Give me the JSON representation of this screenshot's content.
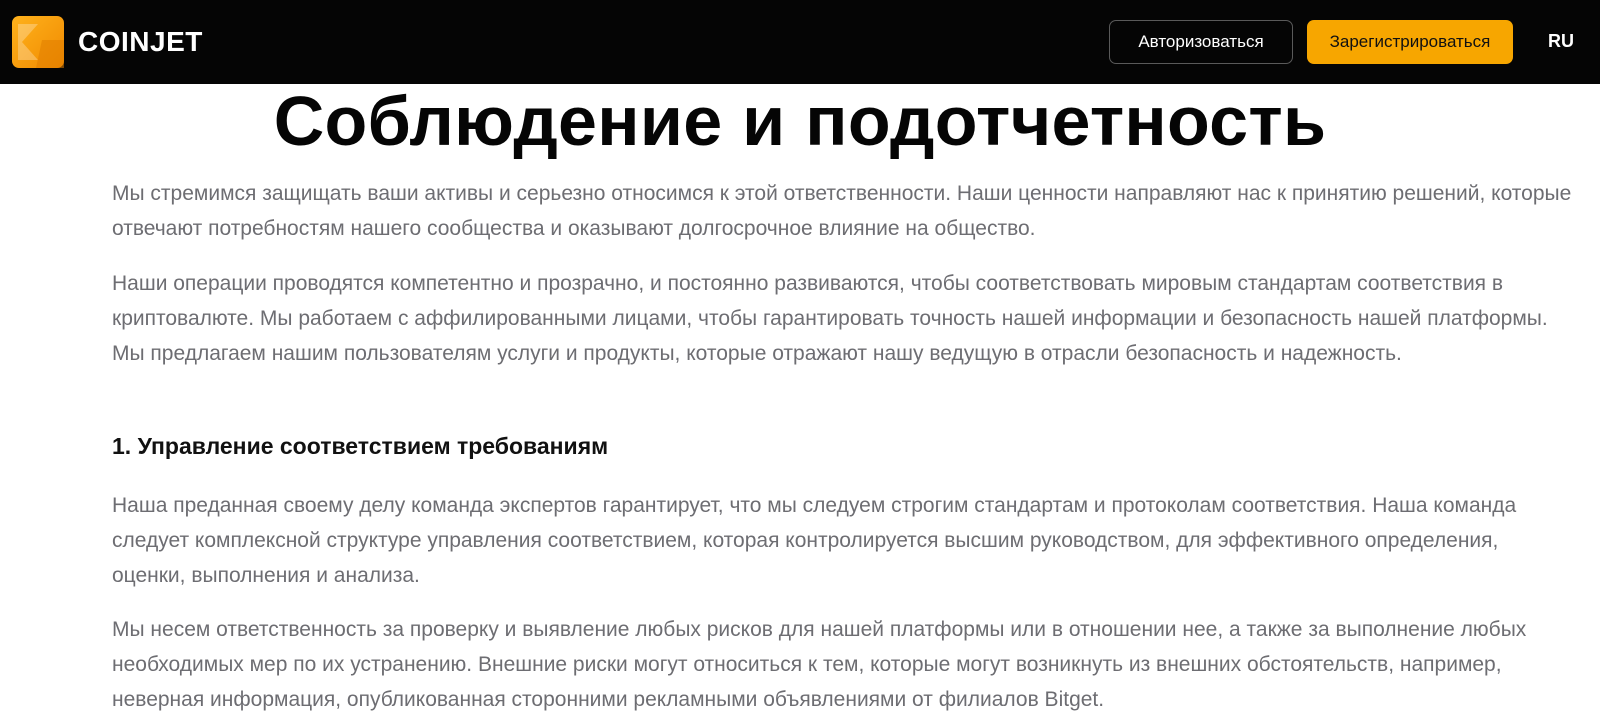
{
  "header": {
    "brand": "COINJET",
    "login_label": "Авторизоваться",
    "register_label": "Зарегистрироваться",
    "language": "RU",
    "accent_color": "#f7a600",
    "logo_icon": "coinjet-logo-icon"
  },
  "page": {
    "title": "Соблюдение и подотчетность",
    "intro_1": "Мы стремимся защищать ваши активы и серьезно относимся к этой ответственности. Наши ценности направляют нас к принятию решений, которые отвечают потребностям нашего сообщества и оказывают долгосрочное влияние на общество.",
    "intro_2": "Наши операции проводятся компетентно и прозрачно, и постоянно развиваются, чтобы соответствовать мировым стандартам соответствия в криптовалюте. Мы работаем с аффилированными лицами, чтобы гарантировать точность нашей информации и безопасность нашей платформы. Мы предлагаем нашим пользователям услуги и продукты, которые отражают нашу ведущую в отрасли безопасность и надежность.",
    "section_1_heading": "1. Управление соответствием требованиям",
    "section_1_p1": "Наша преданная своему делу команда экспертов гарантирует, что мы следуем строгим стандартам и протоколам соответствия. Наша команда следует комплексной структуре управления соответствием, которая контролируется высшим руководством, для эффективного определения, оценки, выполнения и анализа.",
    "section_1_p2": "Мы несем ответственность за проверку и выявление любых рисков для нашей платформы или в отношении нее, а также за выполнение любых необходимых мер по их устранению. Внешние риски могут относиться к тем, которые могут возникнуть из внешних обстоятельств, например, неверная информация, опубликованная сторонними рекламными объявлениями от филиалов Bitget."
  }
}
